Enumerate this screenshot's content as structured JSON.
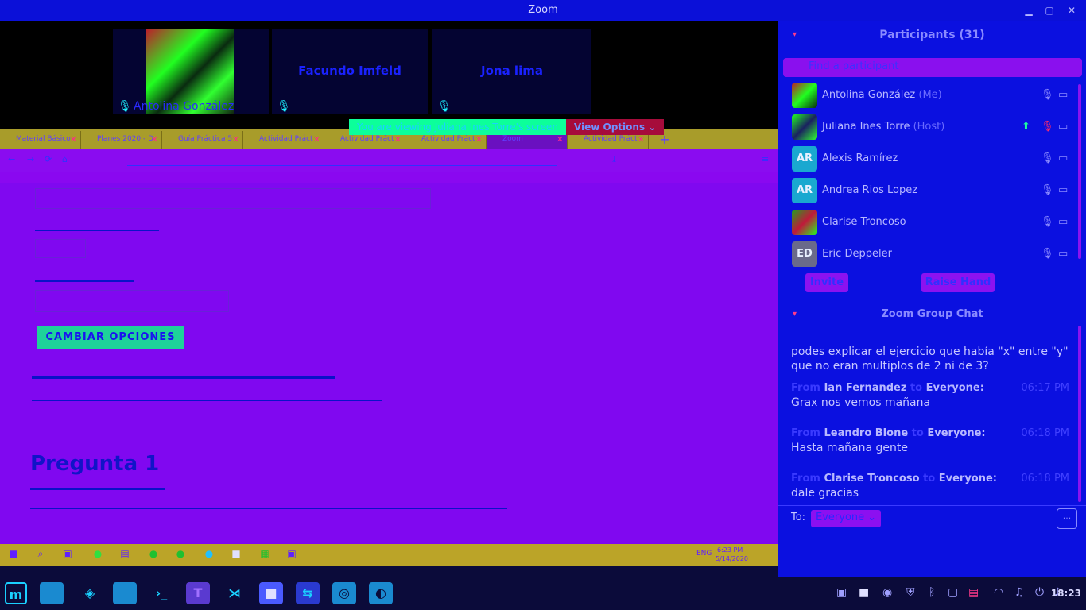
{
  "window": {
    "title": "Zoom"
  },
  "videos": [
    {
      "name": "Antolina González"
    },
    {
      "name": "Facundo Imfeld"
    },
    {
      "name": "Jona lima"
    }
  ],
  "share_banner": {
    "message": "You are viewing Juliana Ines Torre's screen",
    "button": "View Options"
  },
  "shared_screen": {
    "tabs": [
      "Material Básico",
      "Planes 2020 - D",
      "Guía Práctica 5",
      "Actividad Práct",
      "Actividad Práct",
      "Actividad Práct",
      "Zoom",
      "Actividad Práct"
    ],
    "button": "CAMBIAR OPCIONES",
    "heading": "Pregunta 1",
    "clock_time": "6:23 PM",
    "clock_date": "5/14/2020",
    "lang": "ENG"
  },
  "participants": {
    "title": "Participants (31)",
    "search_placeholder": "Find a participant",
    "list": [
      {
        "name": "Antolina González",
        "tag": "(Me)",
        "initials": ""
      },
      {
        "name": "Juliana Ines Torre",
        "tag": "(Host)",
        "initials": ""
      },
      {
        "name": "Alexis Ramírez",
        "tag": "",
        "initials": "AR"
      },
      {
        "name": "Andrea Rios Lopez",
        "tag": "",
        "initials": "AR"
      },
      {
        "name": "Clarise Troncoso",
        "tag": "",
        "initials": ""
      },
      {
        "name": "Eric Deppeler",
        "tag": "",
        "initials": "ED"
      }
    ],
    "invite": "Invite",
    "raise_hand": "Raise Hand"
  },
  "chat": {
    "title": "Zoom Group Chat",
    "from_word": "From",
    "to_word": "to",
    "messages": [
      {
        "from": "",
        "to": "",
        "time": "",
        "text": "podes explicar el ejercicio que había \"x\" entre \"y\" que no eran multiplos de 2 ni de 3?"
      },
      {
        "from": "Ian Fernandez",
        "to": "Everyone:",
        "time": "06:17 PM",
        "text": "Grax nos vemos mañana"
      },
      {
        "from": "Leandro Blone",
        "to": "Everyone:",
        "time": "06:18 PM",
        "text": "Hasta mañana gente"
      },
      {
        "from": "Clarise Troncoso",
        "to": "Everyone:",
        "time": "06:18 PM",
        "text": "dale gracias"
      }
    ],
    "to_label": "To:",
    "to_value": "Everyone"
  },
  "taskbar": {
    "clock": "18:23"
  }
}
